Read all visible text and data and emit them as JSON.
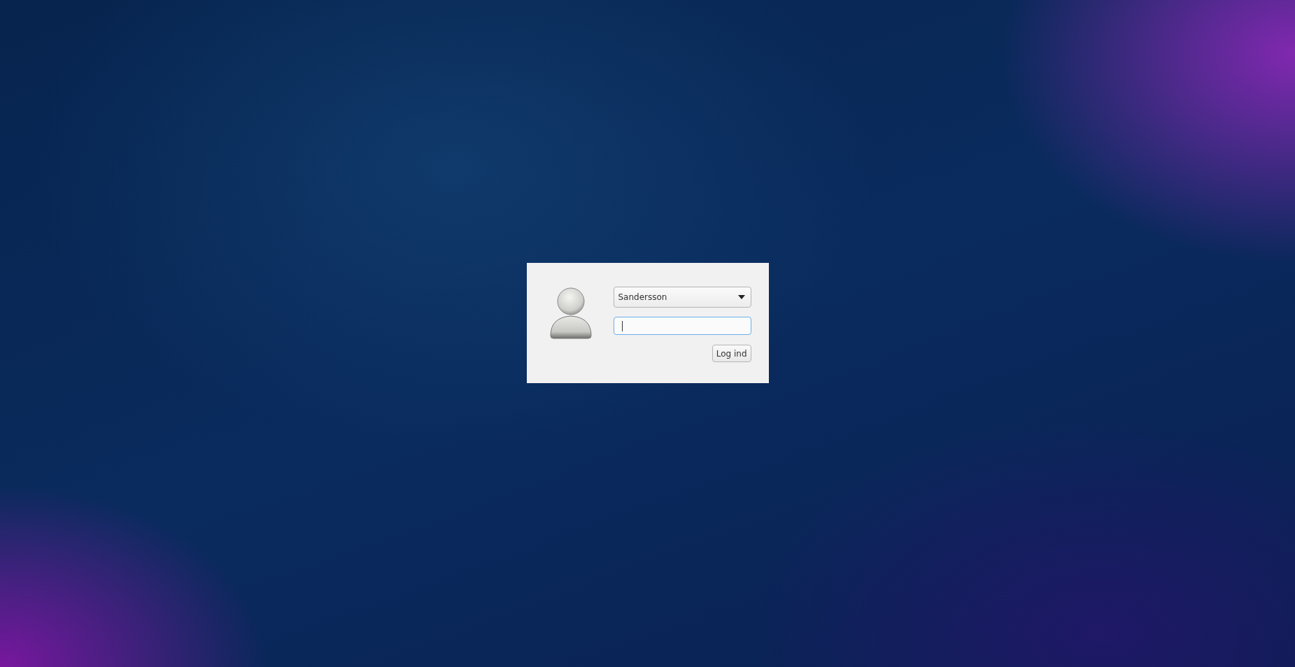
{
  "login": {
    "user_select": {
      "value": "Sandersson"
    },
    "password_field": {
      "focused": true
    },
    "button": {
      "label": "Log ind"
    }
  }
}
